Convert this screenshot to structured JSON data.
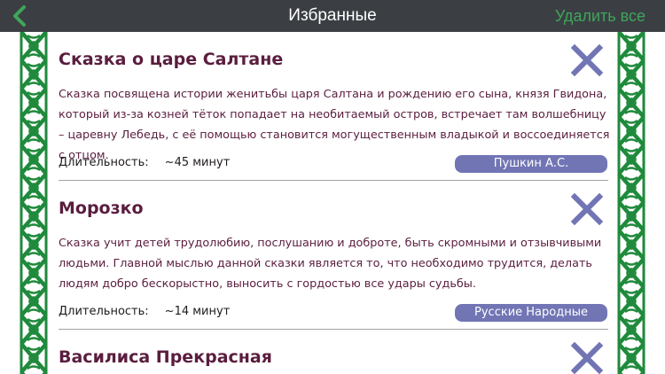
{
  "nav": {
    "title": "Избранные",
    "delete_all": "Удалить все",
    "back_icon": "chevron-left-icon"
  },
  "colors": {
    "navbar_bg": "#3b3f44",
    "accent_green": "#3fa55a",
    "title_purple": "#5a1d3e",
    "badge_bg": "#7175b4",
    "remove_x": "#7175b4",
    "ornament_green": "#1f8a3c"
  },
  "duration_label": "Длительность:",
  "cards": [
    {
      "title": "Сказка о царе Салтане",
      "description": "Сказка посвящена истории женитьбы царя Салтана и рождению его сына, князя Гвидона, который из-за козней тёток попадает на необитаемый остров, встречает там волшебницу – царевну Лебедь, с её помощью становится могущественным владыкой и воссоединяется с отцом.",
      "duration": "~45 минут",
      "author": "Пушкин А.С."
    },
    {
      "title": "Морозко",
      "description": "Сказка учит детей трудолюбию, послушанию и доброте, быть скромными и отзывчивыми людьми. Главной мыслью данной сказки является то, что необходимо трудится, делать людям добро бескорыстно, выносить с гордостью все удары судьбы.",
      "duration": "~14 минут",
      "author": "Русские Народные"
    },
    {
      "title": "Василиса Прекрасная",
      "description": "",
      "duration": "",
      "author": ""
    }
  ]
}
